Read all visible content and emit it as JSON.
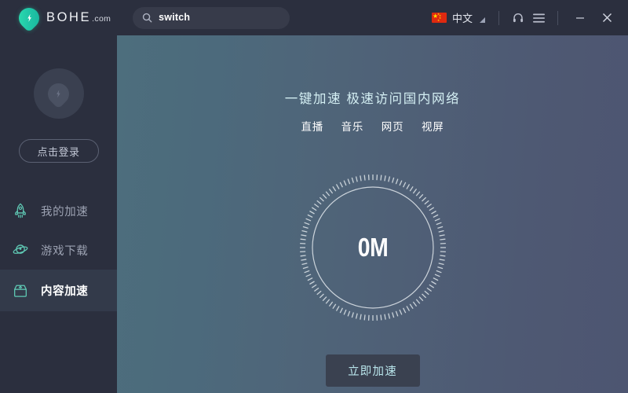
{
  "window": {
    "brand_name": "BOHE",
    "brand_tld": ".com",
    "logo_icon": "bohe-shield-bolt-icon",
    "minimize_label": "–",
    "close_label": "✕"
  },
  "search": {
    "icon": "search-icon",
    "value": "switch",
    "placeholder": "switch"
  },
  "titlebar_right": {
    "flag_icon": "china-flag-icon",
    "language_label": "中文",
    "language_dropdown_icon": "corner-triangle-icon",
    "headset_icon": "headset-icon",
    "menu_icon": "hamburger-menu-icon",
    "minimize_icon": "minimize-icon",
    "close_icon": "close-icon"
  },
  "sidebar": {
    "avatar_icon": "avatar-logo-icon",
    "login_label": "点击登录",
    "items": [
      {
        "label": "我的加速",
        "icon": "rocket-icon",
        "active": false
      },
      {
        "label": "游戏下载",
        "icon": "planet-icon",
        "active": false
      },
      {
        "label": "内容加速",
        "icon": "content-box-icon",
        "active": true
      }
    ]
  },
  "main": {
    "title": "一键加速 极速访问国内网络",
    "tags": [
      "直播",
      "音乐",
      "网页",
      "视屏"
    ],
    "gauge_value": "0M",
    "cta_label": "立即加速"
  },
  "colors": {
    "chrome": "#2b2f3e",
    "accent_teal": "#2fe0b0",
    "active_item_bg": "#333a4a",
    "hero_title": "#d3eef2",
    "cta_text": "#b8e4ea",
    "gradient_left": "#4d6e7d",
    "gradient_right": "#4d5571"
  }
}
